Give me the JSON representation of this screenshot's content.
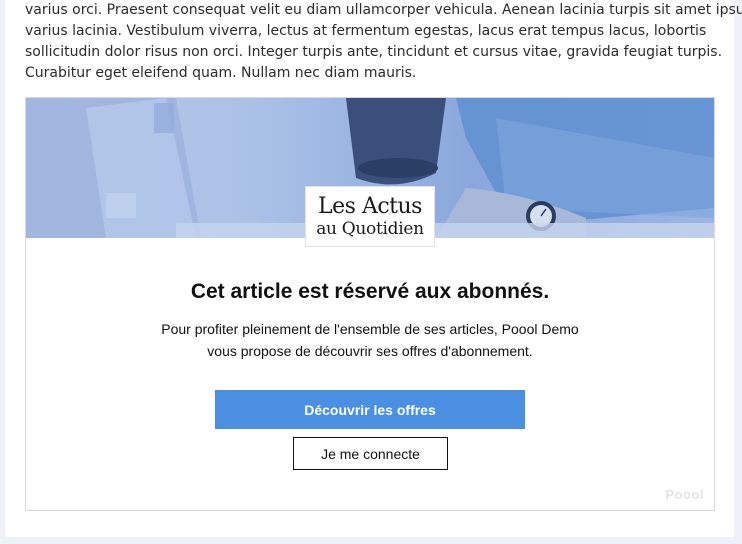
{
  "article": {
    "lines": [
      "varius orci. Praesent consequat velit eu diam ullamcorper vehicula. Aenean lacinia turpis sit amet ipsum",
      "varius lacinia. Vestibulum viverra, lectus at fermentum egestas, lacus erat tempus lacus, lobortis",
      "sollicitudin dolor risus non orci. Integer turpis ante, tincidunt et cursus vitae, gravida feugiat turpis.",
      "Curabitur eget eleifend quam. Nullam nec diam mauris."
    ]
  },
  "paywall": {
    "logo_line1": "Les Actus",
    "logo_line2": "au Quotidien",
    "headline": "Cet article est réservé aux abonnés.",
    "description_line1": "Pour profiter pleinement de l'ensemble de ses articles, Poool Demo",
    "description_line2": "vous propose de découvrir ses offres d'abonnement.",
    "primary_button": "Découvrir les offres",
    "secondary_button": "Je me connecte",
    "brand": "Poool",
    "accent_color": "#4a8fe2"
  }
}
